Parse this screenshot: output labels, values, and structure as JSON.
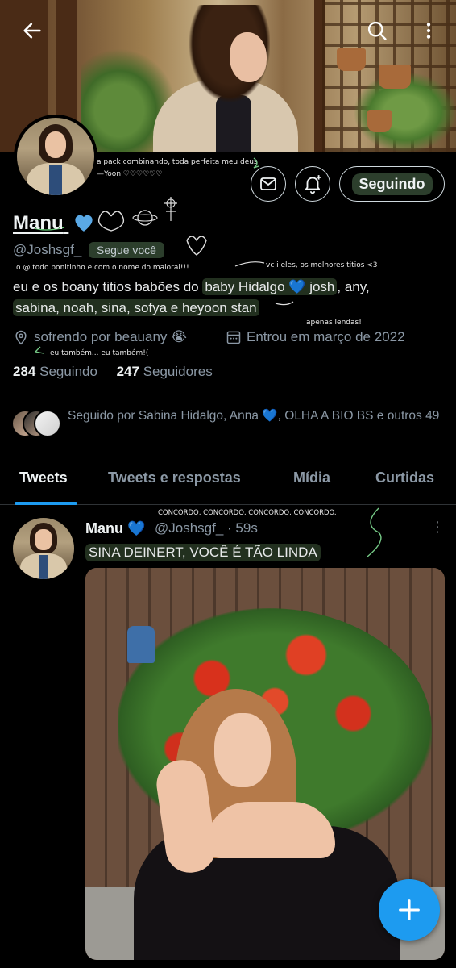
{
  "banner": {
    "description_icon": "header-photo"
  },
  "topbar": {
    "back_icon": "arrow-left-icon",
    "search_icon": "search-icon",
    "more_icon": "more-vertical-icon"
  },
  "actions": {
    "message_icon": "mail-icon",
    "notify_icon": "bell-plus-icon",
    "follow_label": "Seguindo"
  },
  "profile": {
    "name": "Manu",
    "handle": "@Joshsgf_",
    "follows_you": "Segue você",
    "bio_line1_a": "eu e os boany titios babões do ",
    "bio_line1_b": "baby Hidalgo 💙 josh",
    "bio_line1_c": ", any,",
    "bio_line2": "sabina, noah, sina, sofya e heyoon stan",
    "location": "sofrendo por beauany 😭",
    "joined": "Entrou em março de 2022",
    "following_count": "284",
    "following_label": "Seguindo",
    "followers_count": "247",
    "followers_label": "Seguidores",
    "followed_by": "Seguido por Sabina Hidalgo, Anna 💙, OLHA A BIO BS e outros 49"
  },
  "notes": {
    "pack": "a pack combinando, toda perfeita meu deus",
    "yoon": "—Yoon ♡♡♡♡♡♡",
    "handle_note": "o @ todo bonitinho e com o nome do maioral!!!",
    "bio_note": "vc i eles, os melhores titios <3",
    "legends": "apenas lendas!",
    "me_too": "eu também... eu também!(",
    "agree": "CONCORDO, CONCORDO, CONCORDO, CONCORDO."
  },
  "tabs": [
    "Tweets",
    "Tweets e respostas",
    "Mídia",
    "Curtidas"
  ],
  "tweet": {
    "name": "Manu 💙",
    "handle": "@Joshsgf_ · 59s",
    "text": "SINA DEINERT, VOCÊ É TÃO LINDA",
    "more": "⋮"
  },
  "colors": {
    "accent": "#1d9bf0",
    "highlight": "#22301f",
    "heart_blue": "#5aa9e6"
  }
}
